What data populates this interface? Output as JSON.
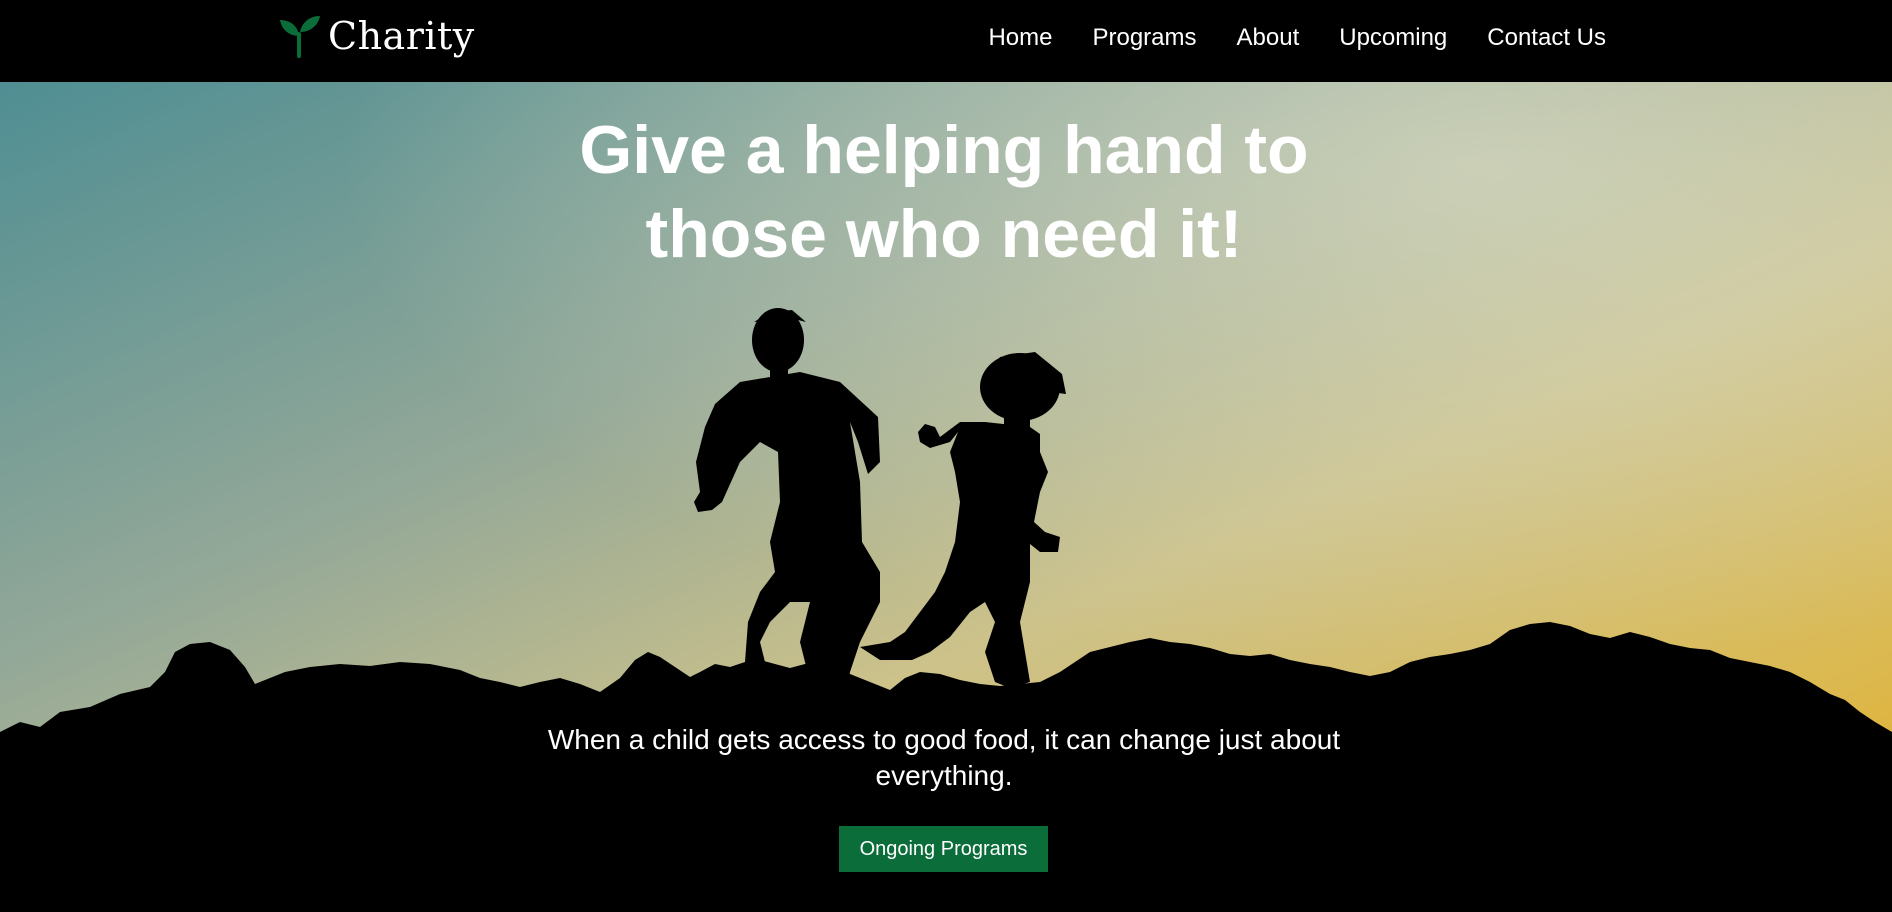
{
  "brand": {
    "name": "Charity",
    "logo_icon": "sprout-icon",
    "accent_color": "#0b6e3a"
  },
  "nav": {
    "items": [
      {
        "label": "Home"
      },
      {
        "label": "Programs"
      },
      {
        "label": "About"
      },
      {
        "label": "Upcoming"
      },
      {
        "label": "Contact Us"
      }
    ]
  },
  "hero": {
    "title": "Give a helping hand to\nthose who need it!",
    "subtitle": "When a child gets access to good food, it can change just about\neverything.",
    "cta_label": "Ongoing Programs",
    "image_subject": "silhouette of two children jumping on rocky hilltop at sunset",
    "sky_colors": {
      "top_left": "#5a9596",
      "top_right": "#c2c9b0",
      "bottom_right": "#e0b23c"
    }
  }
}
